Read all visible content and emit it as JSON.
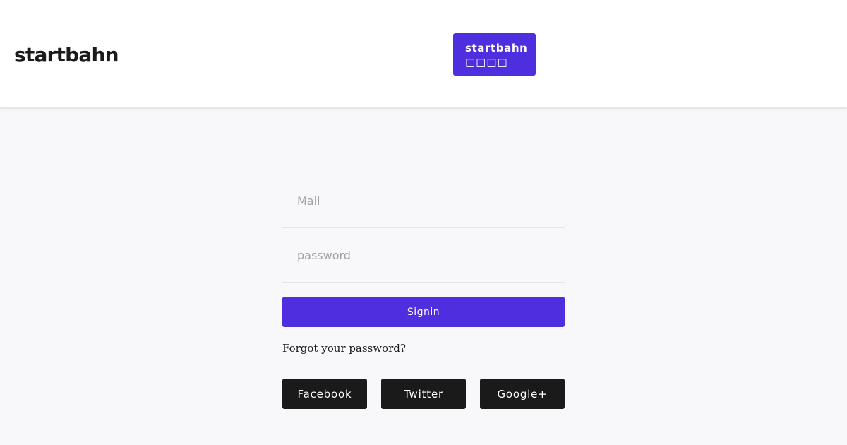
{
  "header": {
    "logo_text": "startbahn",
    "badge": {
      "line1": "startbahn",
      "line2": "□□□□"
    }
  },
  "login_form": {
    "mail_placeholder": "Mail",
    "password_placeholder": "password",
    "signin_label": "Signin",
    "forgot_password_label": "Forgot your password?"
  },
  "social_login": {
    "buttons": [
      {
        "label": "Facebook"
      },
      {
        "label": "Twitter"
      },
      {
        "label": "Google+"
      }
    ]
  },
  "colors": {
    "brand_accent": "#4f2ee0",
    "social_button_bg": "#1a1a1a",
    "page_background": "#f8f8fb",
    "header_background": "#ffffff"
  }
}
